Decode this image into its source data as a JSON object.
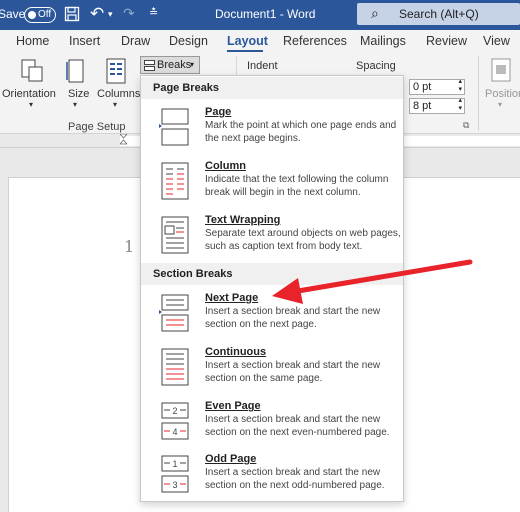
{
  "titlebar": {
    "autosave_label": "Save",
    "toggle_text": "Off",
    "document_title": "Document1 - Word",
    "search_placeholder": "Search (Alt+Q)"
  },
  "tabs": [
    {
      "label": "Home"
    },
    {
      "label": "Insert"
    },
    {
      "label": "Draw"
    },
    {
      "label": "Design"
    },
    {
      "label": "Layout"
    },
    {
      "label": "References"
    },
    {
      "label": "Mailings"
    },
    {
      "label": "Review"
    },
    {
      "label": "View"
    }
  ],
  "active_tab": "Layout",
  "ribbon": {
    "orientation_label": "Orientation",
    "size_label": "Size",
    "columns_label": "Columns",
    "breaks_label": "Breaks",
    "indent_label": "Indent",
    "spacing_label": "Spacing",
    "spacing_before": "0 pt",
    "spacing_after": "8 pt",
    "position_label": "Position",
    "page_setup_label": "Page Setup"
  },
  "document": {
    "line_number": "1"
  },
  "breaks_menu": {
    "page_breaks_header": "Page Breaks",
    "section_breaks_header": "Section Breaks",
    "page_items": [
      {
        "name": "Page",
        "desc": "Mark the point at which one page ends and the next page begins."
      },
      {
        "name": "Column",
        "desc": "Indicate that the text following the column break will begin in the next column."
      },
      {
        "name": "Text Wrapping",
        "desc": "Separate text around objects on web pages, such as caption text from body text."
      }
    ],
    "section_items": [
      {
        "name": "Next Page",
        "desc": "Insert a section break and start the new section on the next page."
      },
      {
        "name": "Continuous",
        "desc": "Insert a section break and start the new section on the same page."
      },
      {
        "name": "Even Page",
        "desc": "Insert a section break and start the new section on the next even-numbered page."
      },
      {
        "name": "Odd Page",
        "desc": "Insert a section break and start the new section on the next odd-numbered page."
      }
    ]
  },
  "colors": {
    "word_blue": "#2b579a",
    "arrow_red": "#e8232a"
  }
}
